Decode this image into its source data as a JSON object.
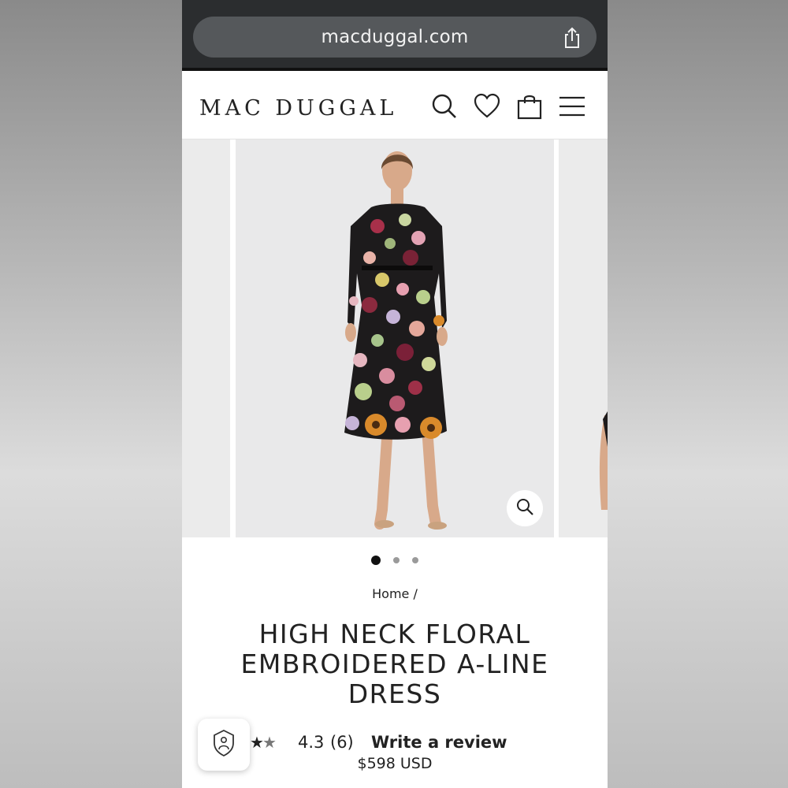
{
  "browser": {
    "url": "macduggal.com",
    "share_icon": "share-icon"
  },
  "header": {
    "logo": "MAC DUGGAL",
    "icons": [
      "search-icon",
      "heart-icon",
      "bag-icon",
      "menu-icon"
    ]
  },
  "gallery": {
    "slide_count": 3,
    "active_slide": 1,
    "zoom_icon": "zoom-icon"
  },
  "breadcrumb": "Home /",
  "product": {
    "title_lines": [
      "HIGH NECK FLORAL",
      "EMBROIDERED A-LINE",
      "DRESS"
    ],
    "stars": "★★",
    "rating": "4.3",
    "review_count": "(6)",
    "write_review": "Write a review",
    "price": "$598 USD"
  },
  "colors": {
    "browser_bar": "#2b2d2f",
    "url_pill": "#55585b",
    "text": "#222222"
  }
}
